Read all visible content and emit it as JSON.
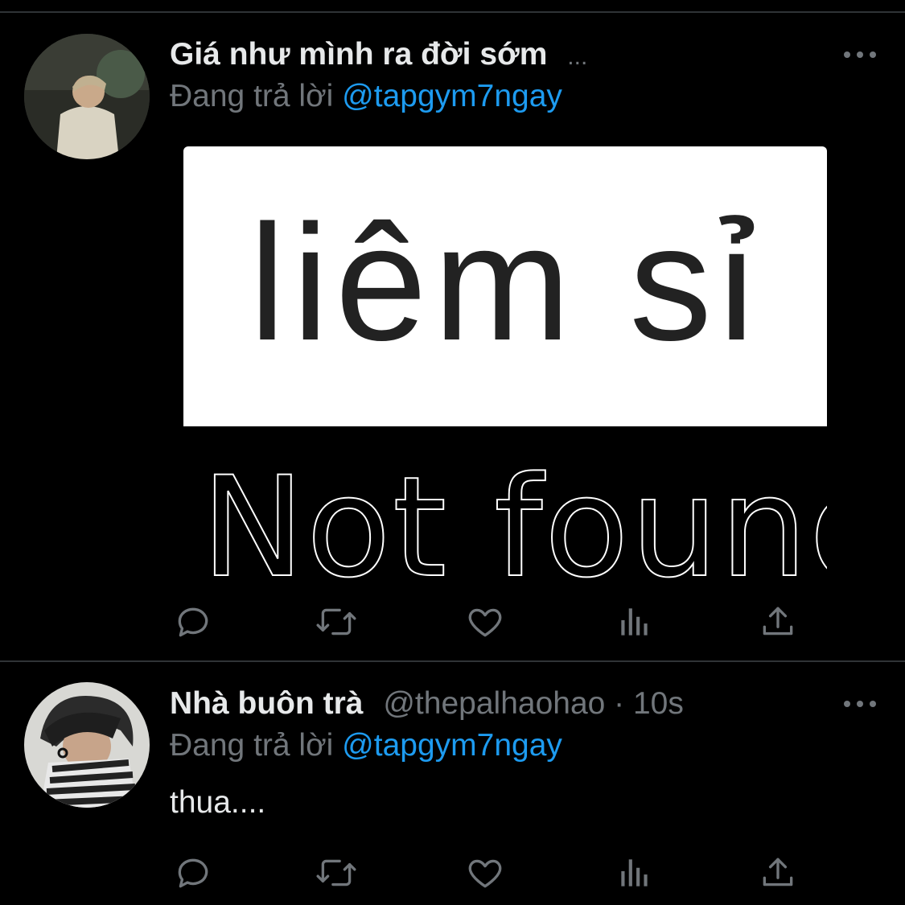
{
  "tweets": [
    {
      "display_name": "Giá như mình ra đời sớm",
      "handle_time": "...",
      "replying_prefix": "Đang trả lời",
      "replying_to": "@tapgym7ngay",
      "media": {
        "main_text": "liêm sỉ",
        "sub_text": "Not found"
      }
    },
    {
      "display_name": "Nhà buôn trà",
      "handle_time": "@thepalhaohao · 10s",
      "replying_prefix": "Đang trả lời",
      "replying_to": "@tapgym7ngay",
      "text": "thua...."
    }
  ],
  "action_icons": [
    "reply-icon",
    "retweet-icon",
    "like-icon",
    "analytics-icon",
    "share-icon"
  ],
  "colors": {
    "background": "#000000",
    "text": "#e7e9ea",
    "muted": "#71767b",
    "accent": "#1d9bf0"
  }
}
